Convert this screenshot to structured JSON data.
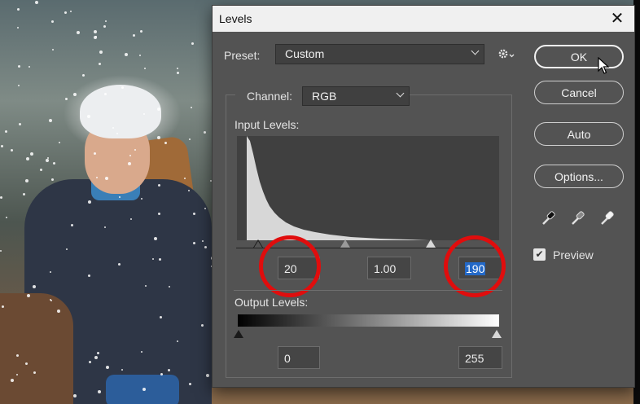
{
  "dialog": {
    "title": "Levels",
    "close_glyph": "✕",
    "preset_label": "Preset:",
    "preset_value": "Custom",
    "channel_label": "Channel:",
    "channel_value": "RGB",
    "input_levels_label": "Input Levels:",
    "input_black": "20",
    "input_gamma": "1.00",
    "input_white": "190",
    "output_levels_label": "Output Levels:",
    "output_black": "0",
    "output_white": "255",
    "buttons": {
      "ok": "OK",
      "cancel": "Cancel",
      "auto": "Auto",
      "options": "Options..."
    },
    "preview_label": "Preview",
    "preview_checked": true,
    "icons": [
      "gear-icon",
      "black-eyedropper-icon",
      "gray-eyedropper-icon",
      "white-eyedropper-icon",
      "mouse-cursor-icon"
    ],
    "highlight_color": "#e00d0d",
    "selection_color": "#2369c8"
  }
}
